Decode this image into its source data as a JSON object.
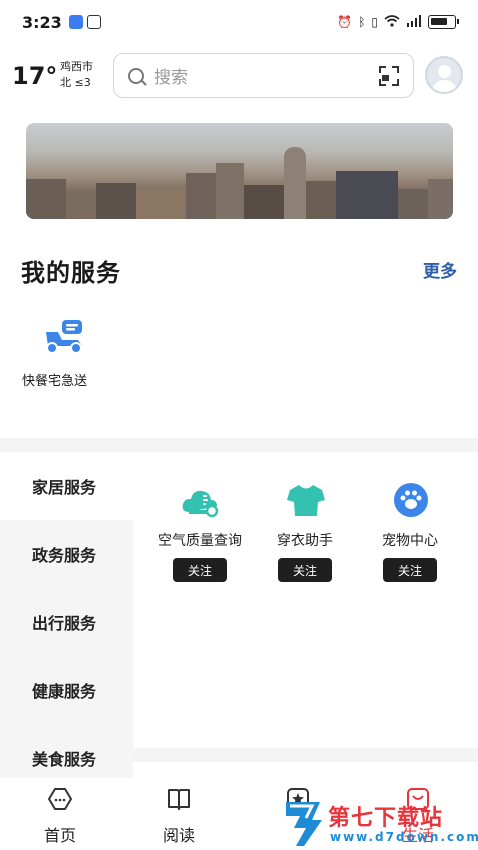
{
  "status_bar": {
    "time": "3:23"
  },
  "weather": {
    "temperature": "17°",
    "city": "鸡西市",
    "wind": "北 ≤3"
  },
  "search": {
    "placeholder": "搜索"
  },
  "my_services": {
    "title": "我的服务",
    "more_label": "更多",
    "items": [
      {
        "label": "快餐宅急送",
        "icon": "delivery-scooter-icon",
        "color": "#3b86e8"
      }
    ]
  },
  "categories": {
    "items": [
      {
        "label": "家居服务",
        "active": true
      },
      {
        "label": "政务服务"
      },
      {
        "label": "出行服务"
      },
      {
        "label": "健康服务"
      },
      {
        "label": "美食服务"
      }
    ]
  },
  "tiles": [
    {
      "label": "空气质量查询",
      "follow_label": "关注",
      "icon": "air-quality-icon",
      "color": "#35c1b0"
    },
    {
      "label": "穿衣助手",
      "follow_label": "关注",
      "icon": "tshirt-icon",
      "color": "#35c1b0"
    },
    {
      "label": "宠物中心",
      "follow_label": "关注",
      "icon": "paw-icon",
      "color": "#3b86e8"
    }
  ],
  "bottom_nav": [
    {
      "label": "首页",
      "icon": "home-icon"
    },
    {
      "label": "阅读",
      "icon": "book-icon"
    },
    {
      "label": "",
      "icon": "star-badge-icon"
    },
    {
      "label": "生活",
      "icon": "life-icon"
    }
  ],
  "watermark": {
    "text": "第七下载站",
    "url": "www.d7down.com",
    "icon": "d7-logo"
  }
}
